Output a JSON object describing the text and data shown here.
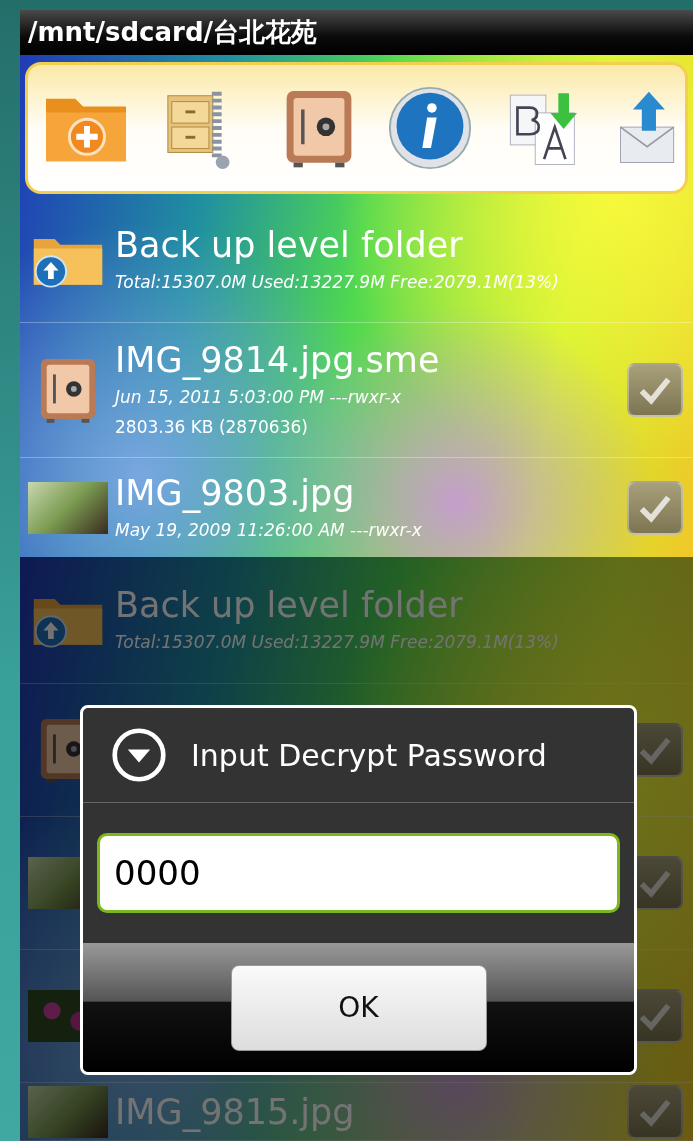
{
  "file_browser": {
    "path_bar": "/mnt/sdcard/台北花苑",
    "rows": [
      {
        "kind": "parent",
        "name": "Back up level folder",
        "details": [
          "Total:15307.0M Used:13227.9M Free:2079.1M(13%)"
        ]
      },
      {
        "kind": "encrypted",
        "name": "IMG_9814.jpg.sme",
        "details": [
          "Jun 15, 2011 5:03:00 PM ---rwxr-x",
          "2803.36 KB (2870636)"
        ],
        "checked": false
      },
      {
        "kind": "image",
        "name": "IMG_9803.jpg",
        "details": [
          "May 19, 2009 11:26:00 AM ---rwxr-x"
        ],
        "checked": false
      }
    ]
  },
  "dimmed_browser": {
    "rows": [
      {
        "kind": "parent",
        "name": "Back up level folder",
        "details": [
          "Total:15307.0M Used:13227.9M Free:2079.1M(13%)"
        ]
      },
      {
        "kind": "encrypted",
        "checked": false
      },
      {
        "kind": "image",
        "checked": false
      },
      {
        "kind": "flowers",
        "checked": false
      },
      {
        "kind": "image",
        "name": "IMG_9815.jpg",
        "checked": false
      }
    ]
  },
  "dialog": {
    "title": "Input Decrypt Password",
    "password_field": {
      "value": "0000"
    },
    "buttons": [
      "OK"
    ]
  }
}
